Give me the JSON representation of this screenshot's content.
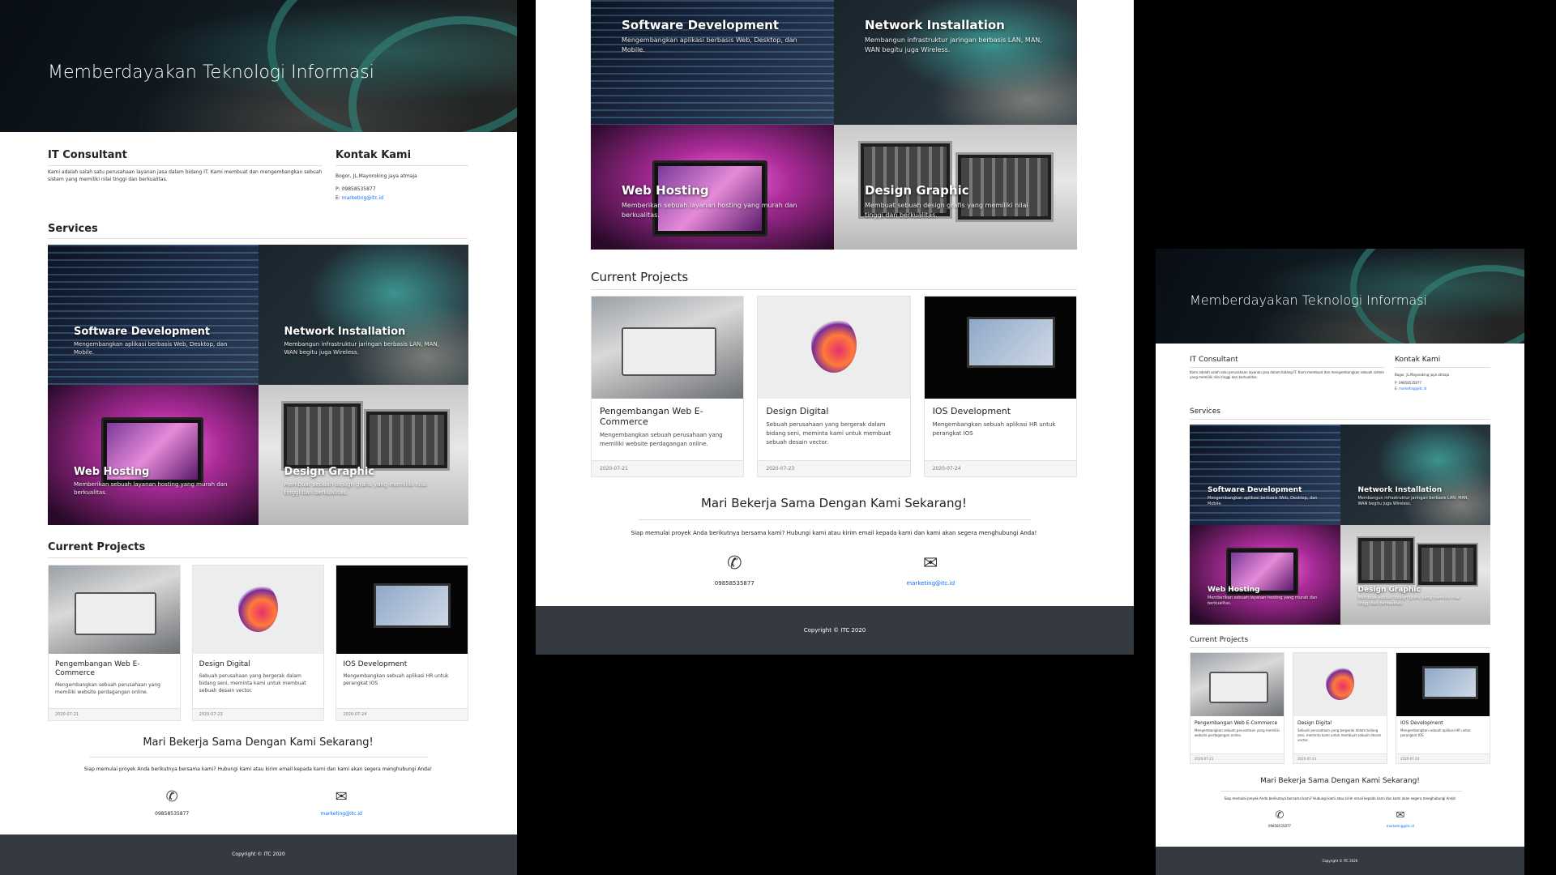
{
  "hero": {
    "title": "Memberdayakan Teknologi Informasi"
  },
  "about": {
    "heading": "IT Consultant",
    "text": "Kami adalah salah satu perusahaan layanan jasa dalam bidang IT. Kami membuat dan mengembangkan sebuah sistem yang memiliki nilai tinggi dan berkualitas."
  },
  "contact": {
    "heading": "Kontak Kami",
    "address": "Bogor, JL.Mayoroking jaya atmaja",
    "phone_prefix": "P:",
    "phone": "09858535877",
    "email_prefix": "E:",
    "email": "marketing@itc.id"
  },
  "services": {
    "heading": "Services",
    "items": [
      {
        "title": "Software Development",
        "desc": "Mengembangkan aplikasi berbasis Web, Desktop, dan Mobile."
      },
      {
        "title": "Network Installation",
        "desc": "Membangun infrastruktur jaringan berbasis LAN, MAN, WAN begitu juga Wireless."
      },
      {
        "title": "Web Hosting",
        "desc": "Memberikan sebuah layanan hosting yang murah dan berkualitas."
      },
      {
        "title": "Design Graphic",
        "desc": "Membuat sebuah design grafis yang memiliki nilai tinggi dan berkualitas."
      }
    ]
  },
  "projects": {
    "heading": "Current Projects",
    "items": [
      {
        "title": "Pengembangan Web E-Commerce",
        "desc": "Mengembangkan sebuah perusahaan yang memiliki website perdagangan online.",
        "date": "2020-07-21"
      },
      {
        "title": "Design Digital",
        "desc": "Sebuah perusahaan yang bergerak dalam bidang seni, meminta kami untuk membuat sebuah desain vector.",
        "date": "2020-07-23"
      },
      {
        "title": "IOS Development",
        "desc": "Mengembangkan sebuah aplikasi HR untuk perangkat IOS",
        "date": "2020-07-24"
      }
    ]
  },
  "cta": {
    "heading": "Mari Bekerja Sama Dengan Kami Sekarang!",
    "lead": "Siap memulai proyek Anda berikutnya bersama kami? Hubungi kami atau kirim email kepada kami dan kami akan segera menghubungi Anda!",
    "phone": "09858535877",
    "email": "marketing@itc.id"
  },
  "footer": {
    "text": "Copyright © ITC 2020"
  },
  "icons": {
    "phone": "phone-icon",
    "envelope": "envelope-icon"
  },
  "colors": {
    "footer_bg": "#343a40",
    "link": "#0d6efd",
    "hero_cable": "#3fa79c"
  }
}
